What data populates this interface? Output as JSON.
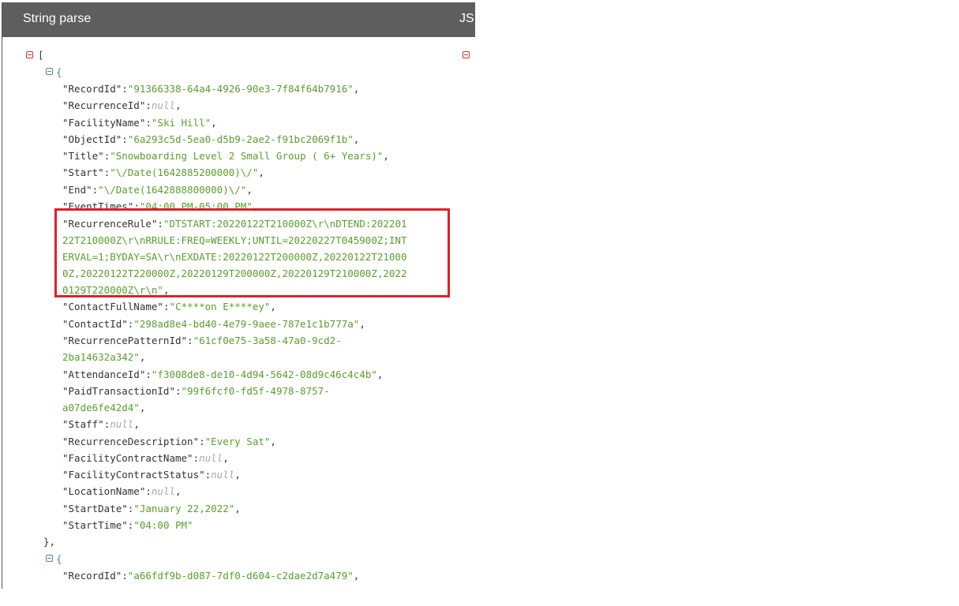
{
  "header": {
    "title": "String parse",
    "right_title": "JS"
  },
  "json": {
    "open_bracket": "[",
    "open_brace": "{",
    "close_brace": "},",
    "r1": {
      "RecordId": {
        "key": "\"RecordId\"",
        "value": "\"91366338-64a4-4926-90e3-7f84f64b7916\""
      },
      "RecurrenceId": {
        "key": "\"RecurrenceId\"",
        "value": "null"
      },
      "FacilityName": {
        "key": "\"FacilityName\"",
        "value": "\"Ski Hill\""
      },
      "ObjectId": {
        "key": "\"ObjectId\"",
        "value": "\"6a293c5d-5ea0-d5b9-2ae2-f91bc2069f1b\""
      },
      "Title": {
        "key": "\"Title\"",
        "value": "\"Snowboarding Level 2 Small Group ( 6+ Years)\""
      },
      "Start": {
        "key": "\"Start\"",
        "value": "\"\\/Date(1642885200000)\\/\""
      },
      "End": {
        "key": "\"End\"",
        "value": "\"\\/Date(1642888800000)\\/\""
      },
      "EventTimes": {
        "key": "\"EventTimes\"",
        "value": "\"04:00 PM-05:00 PM\""
      },
      "RecurrenceRule": {
        "key": "\"RecurrenceRule\"",
        "value_l1": "\"DTSTART:20220122T210000Z\\r\\nDTEND:202201",
        "value_l2": "22T210000Z\\r\\nRRULE:FREQ=WEEKLY;UNTIL=20220227T045900Z;INT",
        "value_l3": "ERVAL=1;BYDAY=SA\\r\\nEXDATE:20220122T200000Z,20220122T21000",
        "value_l4": "0Z,20220122T220000Z,20220129T200000Z,20220129T210000Z,2022",
        "value_l5": "0129T220000Z\\r\\n\""
      },
      "ContactFullName": {
        "key": "\"ContactFullName\"",
        "value": "\"C****on E****ey\""
      },
      "ContactId": {
        "key": "\"ContactId\"",
        "value": "\"298ad8e4-bd40-4e79-9aee-787e1c1b777a\""
      },
      "RecurrencePatternId": {
        "key": "\"RecurrencePatternId\"",
        "value_l1": "\"61cf0e75-3a58-47a0-9cd2-",
        "value_l2": "2ba14632a342\""
      },
      "AttendanceId": {
        "key": "\"AttendanceId\"",
        "value": "\"f3008de8-de10-4d94-5642-08d9c46c4c4b\""
      },
      "PaidTransactionId": {
        "key": "\"PaidTransactionId\"",
        "value_l1": "\"99f6fcf0-fd5f-4978-8757-",
        "value_l2": "a07de6fe42d4\""
      },
      "Staff": {
        "key": "\"Staff\"",
        "value": "null"
      },
      "RecurrenceDescription": {
        "key": "\"RecurrenceDescription\"",
        "value": "\"Every Sat\""
      },
      "FacilityContractName": {
        "key": "\"FacilityContractName\"",
        "value": "null"
      },
      "FacilityContractStatus": {
        "key": "\"FacilityContractStatus\"",
        "value": "null"
      },
      "LocationName": {
        "key": "\"LocationName\"",
        "value": "null"
      },
      "StartDate": {
        "key": "\"StartDate\"",
        "value": "\"January 22,2022\""
      },
      "StartTime": {
        "key": "\"StartTime\"",
        "value": "\"04:00 PM\""
      }
    },
    "r2": {
      "RecordId": {
        "key": "\"RecordId\"",
        "value": "\"a66fdf9b-d087-7df0-d604-c2dae2d7a479\""
      }
    }
  },
  "colors": {
    "header_bg": "#5e5e5e",
    "string": "#5a9e2f",
    "null": "#a8a8a8",
    "highlight": "#e0202b"
  }
}
